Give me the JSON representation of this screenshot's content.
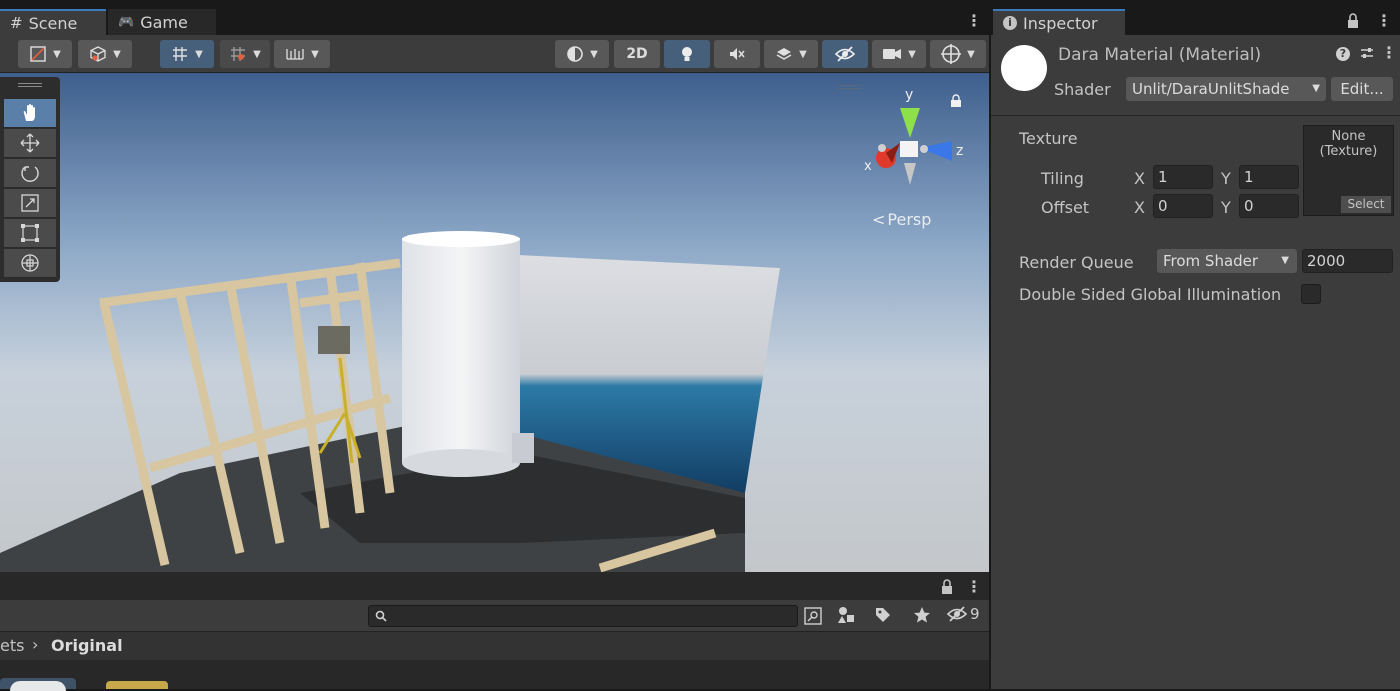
{
  "tabs": {
    "scene": "Scene",
    "game": "Game",
    "inspector": "Inspector"
  },
  "scene_toolbar": {
    "toggle_2d": "2D"
  },
  "gizmo": {
    "axis_y": "y",
    "axis_x": "x",
    "axis_z": "z",
    "projection": "Persp"
  },
  "project": {
    "breadcrumb_parent": "ets",
    "breadcrumb_current": "Original",
    "hidden_count": "9"
  },
  "inspector": {
    "title": "Dara Material (Material)",
    "shader_label": "Shader",
    "shader_value": "Unlit/DaraUnlitShade",
    "edit_button": "Edit...",
    "texture_label": "Texture",
    "tiling_label": "Tiling",
    "offset_label": "Offset",
    "x_label": "X",
    "y_label": "Y",
    "tiling_x": "1",
    "tiling_y": "1",
    "offset_x": "0",
    "offset_y": "0",
    "texture_none": "None",
    "texture_type": "(Texture)",
    "select_button": "Select",
    "render_queue_label": "Render Queue",
    "render_queue_mode": "From Shader",
    "render_queue_value": "2000",
    "dsgi_label": "Double Sided Global Illumination"
  },
  "colors": {
    "accent": "#3a79bb",
    "panel": "#3c3c3c",
    "field": "#2a2a2a"
  }
}
